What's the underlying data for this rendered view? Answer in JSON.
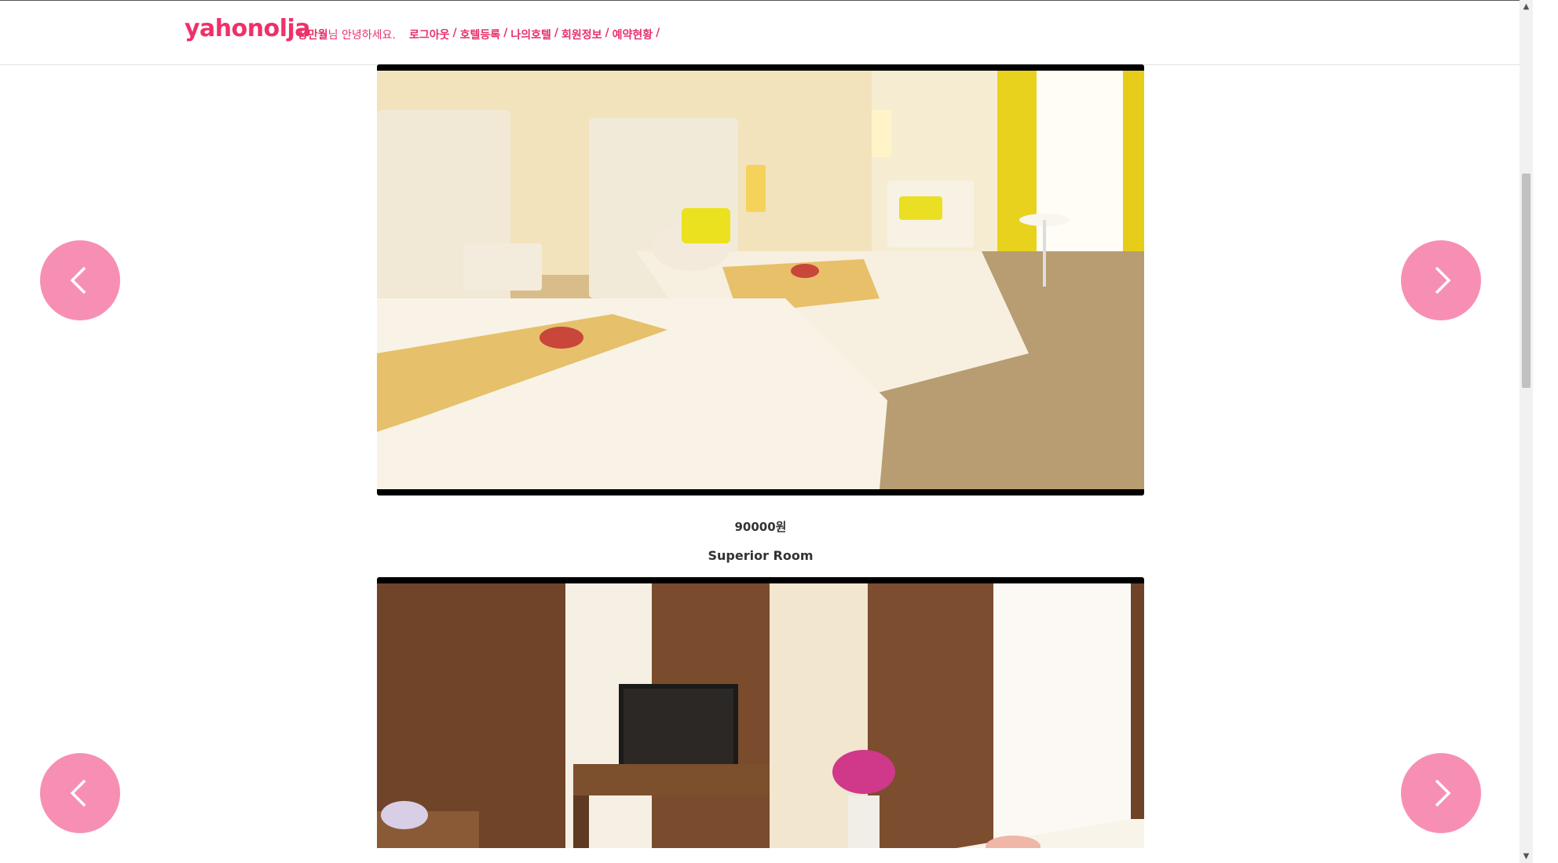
{
  "header": {
    "brand": "yahonolja",
    "user_name": "장만월",
    "greeting_suffix": "님 안녕하세요.",
    "nav": [
      {
        "label": "로그아웃"
      },
      {
        "label": "호텔등록"
      },
      {
        "label": "나의호텔"
      },
      {
        "label": "회원정보"
      },
      {
        "label": "예약현황"
      }
    ],
    "separator": "/"
  },
  "rooms": [
    {
      "image_alt": "twin bed hotel room with yellow curtains",
      "price": "90000원",
      "name": "Superior Room"
    },
    {
      "image_alt": "hotel room with brown curtains and TV"
    }
  ],
  "icons": {
    "prev": "chevron-left-icon",
    "next": "chevron-right-icon"
  },
  "colors": {
    "brand": "#f0306a",
    "arrow_bg": "#f78fb5"
  }
}
